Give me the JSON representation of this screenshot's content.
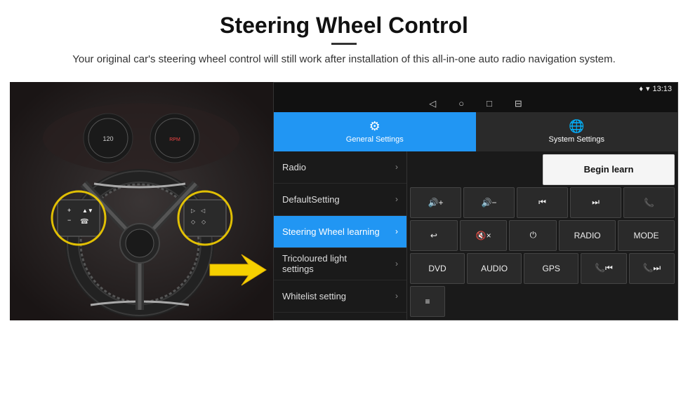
{
  "header": {
    "title": "Steering Wheel Control",
    "subtitle": "Your original car's steering wheel control will still work after installation of this all-in-one auto radio navigation system.",
    "divider": true
  },
  "statusbar": {
    "time": "13:13",
    "icons": [
      "location",
      "wifi",
      "signal"
    ]
  },
  "navbar": {
    "back": "◁",
    "home": "○",
    "recent": "□",
    "cast": "⊟"
  },
  "tabs": {
    "general": {
      "label": "General Settings",
      "icon": "⚙",
      "active": true
    },
    "system": {
      "label": "System Settings",
      "icon": "🌐",
      "active": false
    }
  },
  "menu": {
    "items": [
      {
        "label": "Radio",
        "active": false
      },
      {
        "label": "DefaultSetting",
        "active": false
      },
      {
        "label": "Steering Wheel learning",
        "active": true
      },
      {
        "label": "Tricoloured light settings",
        "active": false
      },
      {
        "label": "Whitelist setting",
        "active": false
      }
    ]
  },
  "buttons": {
    "begin_learn": "Begin learn",
    "rows": [
      [
        {
          "label": "🔊+",
          "id": "vol-up"
        },
        {
          "label": "🔊−",
          "id": "vol-down"
        },
        {
          "label": "⏮",
          "id": "prev"
        },
        {
          "label": "⏭",
          "id": "next"
        },
        {
          "label": "📞",
          "id": "call"
        }
      ],
      [
        {
          "label": "↩",
          "id": "hangup"
        },
        {
          "label": "🔇×",
          "id": "mute"
        },
        {
          "label": "⏻",
          "id": "power"
        },
        {
          "label": "RADIO",
          "id": "radio"
        },
        {
          "label": "MODE",
          "id": "mode"
        }
      ],
      [
        {
          "label": "DVD",
          "id": "dvd"
        },
        {
          "label": "AUDIO",
          "id": "audio"
        },
        {
          "label": "GPS",
          "id": "gps"
        },
        {
          "label": "📞⏮",
          "id": "tel-prev"
        },
        {
          "label": "📞⏭",
          "id": "tel-next"
        }
      ],
      [
        {
          "label": "≡",
          "id": "menu-btn"
        }
      ]
    ]
  }
}
